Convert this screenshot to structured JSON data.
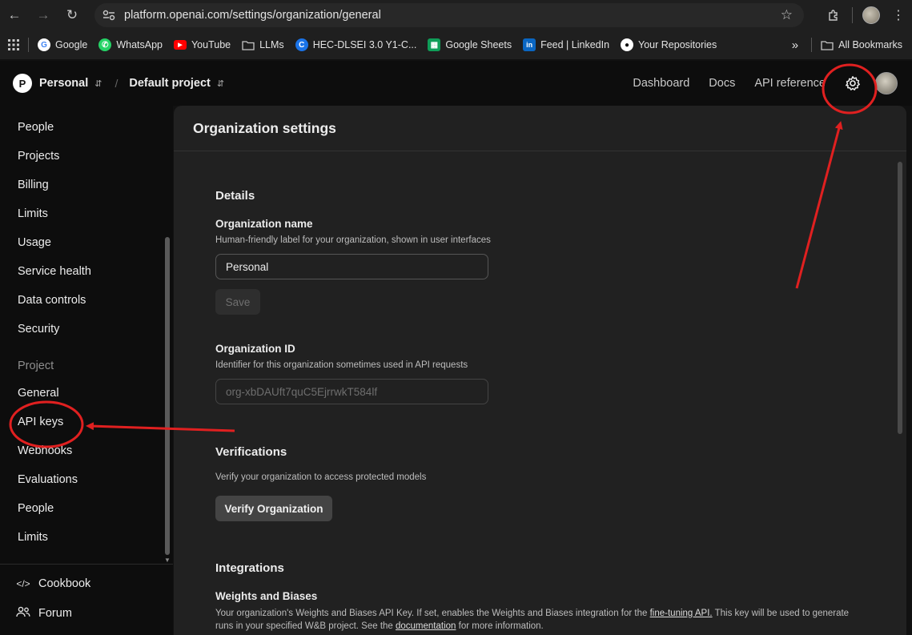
{
  "browser": {
    "url": "platform.openai.com/settings/organization/general",
    "bookmarks": [
      {
        "label": "Google",
        "icon": "google-icon",
        "color": "#ffffff"
      },
      {
        "label": "WhatsApp",
        "icon": "whatsapp-icon",
        "color": "#25d366"
      },
      {
        "label": "YouTube",
        "icon": "youtube-icon",
        "color": "#ff0000"
      },
      {
        "label": "LLMs",
        "icon": "folder-icon",
        "color": "#c7c7c7"
      },
      {
        "label": "HEC-DLSEI 3.0 Y1-C...",
        "icon": "c-icon",
        "color": "#1a73e8"
      },
      {
        "label": "Google Sheets",
        "icon": "sheets-icon",
        "color": "#0f9d58"
      },
      {
        "label": "Feed | LinkedIn",
        "icon": "linkedin-icon",
        "color": "#0a66c2"
      },
      {
        "label": "Your Repositories",
        "icon": "github-icon",
        "color": "#ffffff"
      }
    ],
    "overflow": "»",
    "all_bookmarks": "All Bookmarks"
  },
  "header": {
    "org_initial": "P",
    "org_name": "Personal",
    "project_name": "Default project",
    "links": [
      "Dashboard",
      "Docs",
      "API reference"
    ]
  },
  "sidebar": {
    "org_items": [
      "People",
      "Projects",
      "Billing",
      "Limits",
      "Usage",
      "Service health",
      "Data controls",
      "Security"
    ],
    "project_heading": "Project",
    "project_items": [
      "General",
      "API keys",
      "Webhooks",
      "Evaluations",
      "People",
      "Limits"
    ],
    "bottom_items": [
      {
        "label": "Cookbook",
        "icon": "code-icon"
      },
      {
        "label": "Forum",
        "icon": "people-icon"
      }
    ]
  },
  "main": {
    "title": "Organization settings",
    "details": {
      "heading": "Details",
      "org_name_label": "Organization name",
      "org_name_desc": "Human-friendly label for your organization, shown in user interfaces",
      "org_name_value": "Personal",
      "save_label": "Save",
      "org_id_label": "Organization ID",
      "org_id_desc": "Identifier for this organization sometimes used in API requests",
      "org_id_value": "org-xbDAUft7quC5EjrrwkT584lf"
    },
    "verifications": {
      "heading": "Verifications",
      "desc": "Verify your organization to access protected models",
      "button": "Verify Organization"
    },
    "integrations": {
      "heading": "Integrations",
      "wb_label": "Weights and Biases",
      "wb_text_1": "Your organization's Weights and Biases API Key. If set, enables the Weights and Biases integration for the ",
      "wb_link_1": "fine-tuning API.",
      "wb_text_2": " This key will be used to generate runs in your specified W&B project. See the ",
      "wb_link_2": "documentation",
      "wb_text_3": " for more information."
    }
  },
  "annotation_color": "#e02020"
}
